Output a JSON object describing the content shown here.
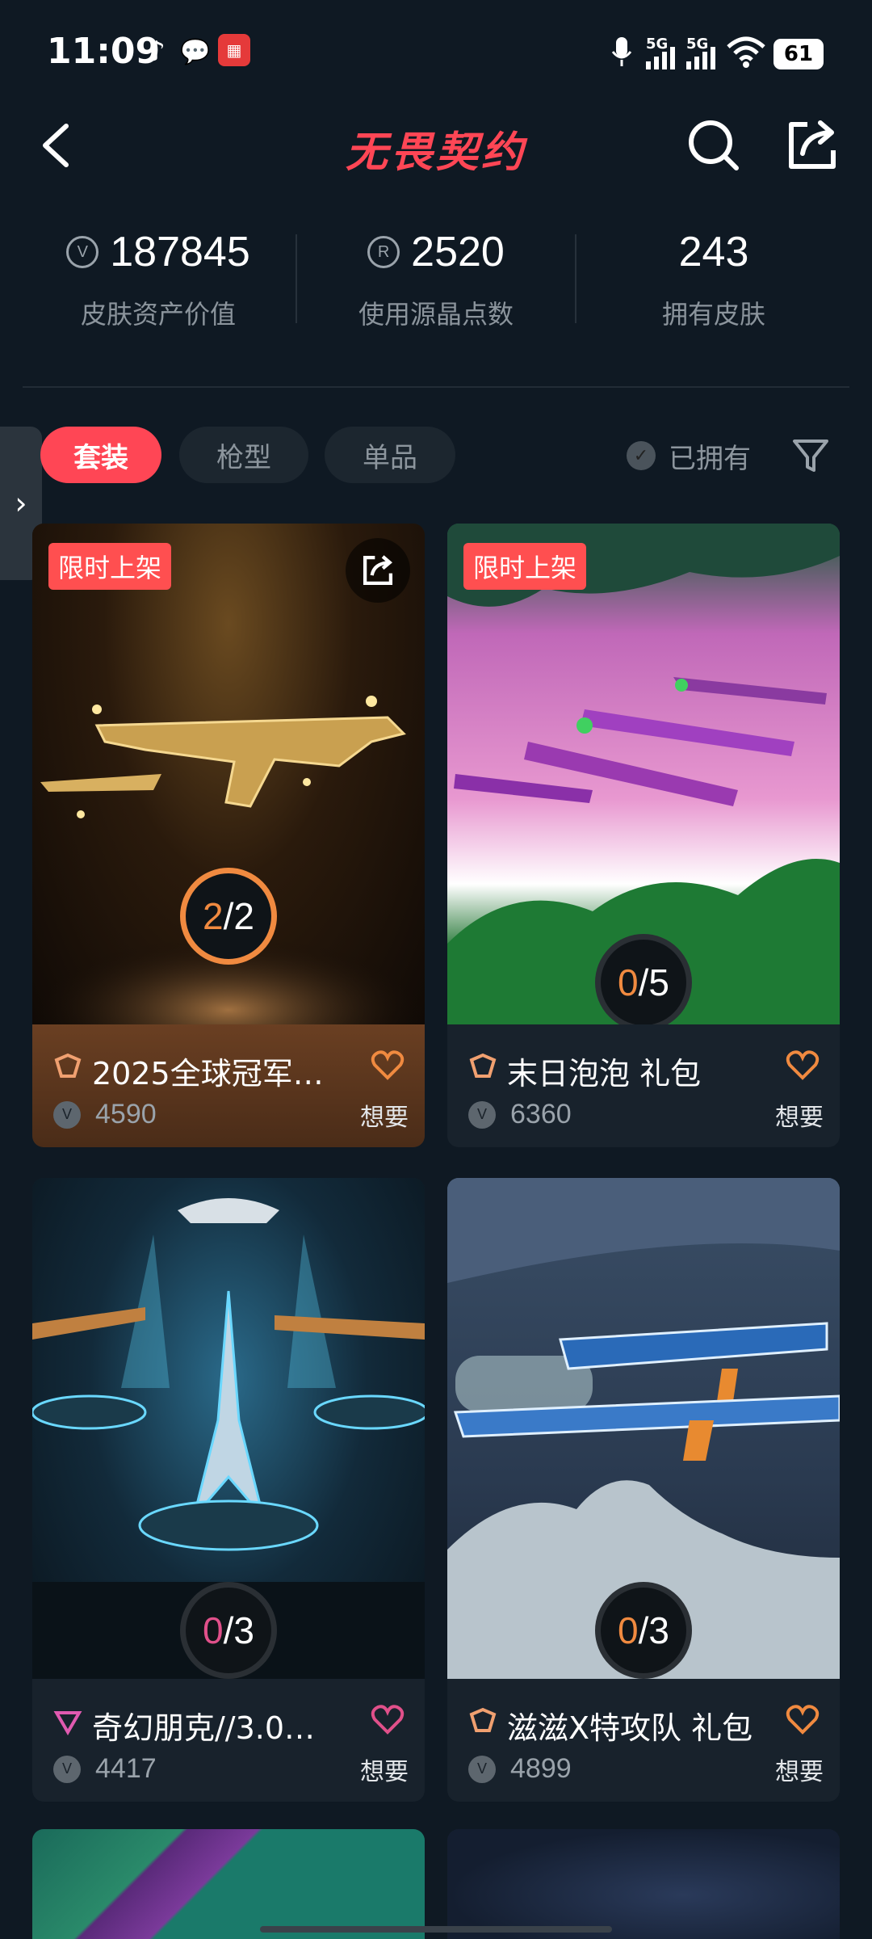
{
  "status": {
    "time": "11:09",
    "network1": "5G",
    "network2": "5G",
    "battery": "61"
  },
  "nav": {
    "title": "无畏契约",
    "back_icon": "back-arrow-icon",
    "search_icon": "search-icon",
    "share_icon": "share-icon"
  },
  "stats": [
    {
      "value": "187845",
      "label": "皮肤资产价值",
      "icon": "vp-coin"
    },
    {
      "value": "2520",
      "label": "使用源晶点数",
      "icon": "radianite-coin"
    },
    {
      "value": "243",
      "label": "拥有皮肤"
    }
  ],
  "tabs": [
    {
      "label": "套装",
      "active": true
    },
    {
      "label": "枪型",
      "active": false
    },
    {
      "label": "单品",
      "active": false
    }
  ],
  "filters": {
    "owned_label": "已拥有",
    "filter_icon": "filter-icon"
  },
  "cards": [
    {
      "tag": "限时上架",
      "name": "2025全球冠军…",
      "price": "4590",
      "count": "2/2",
      "owned": "2",
      "total": "2",
      "want": "想要",
      "rank_color": "#f0a070",
      "accent": "#f08a40"
    },
    {
      "tag": "限时上架",
      "name": "末日泡泡 礼包",
      "price": "6360",
      "count": "0/5",
      "owned": "0",
      "total": "5",
      "want": "想要",
      "rank_color": "#f0a070",
      "accent": "#f08a40"
    },
    {
      "tag": "",
      "name": "奇幻朋克//3.0…",
      "price": "4417",
      "count": "0/3",
      "owned": "0",
      "total": "3",
      "want": "想要",
      "rank_color": "#e05ab0",
      "accent": "#e0508a"
    },
    {
      "tag": "",
      "name": "滋滋X特攻队 礼包",
      "price": "4899",
      "count": "0/3",
      "owned": "0",
      "total": "3",
      "want": "想要",
      "rank_color": "#f0a070",
      "accent": "#f08a40"
    }
  ]
}
